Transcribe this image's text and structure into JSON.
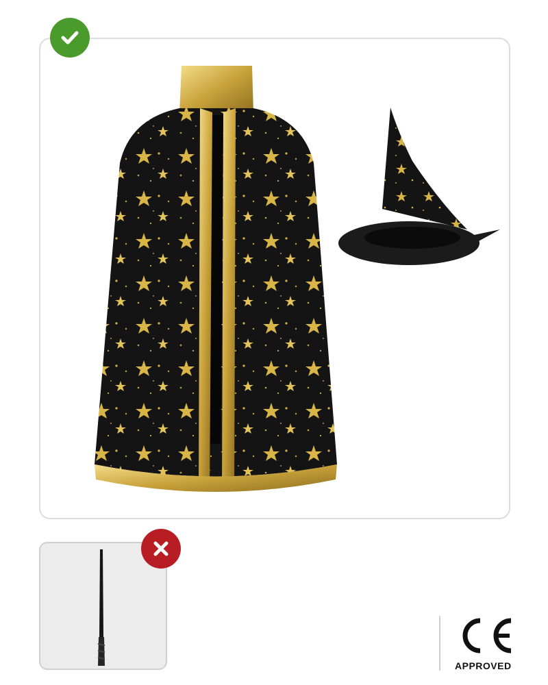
{
  "included": {
    "badge_icon": "check-icon",
    "badge_color": "#4a9a2c",
    "items": [
      "star-cape-image",
      "wizard-hat-image"
    ]
  },
  "excluded": {
    "badge_icon": "close-icon",
    "badge_color": "#b81d24",
    "items": [
      "magic-wand-image"
    ]
  },
  "certification": {
    "mark": "CE",
    "label": "APPROVED"
  },
  "colors": {
    "fabric": "#141414",
    "gold": "#d9b548"
  }
}
